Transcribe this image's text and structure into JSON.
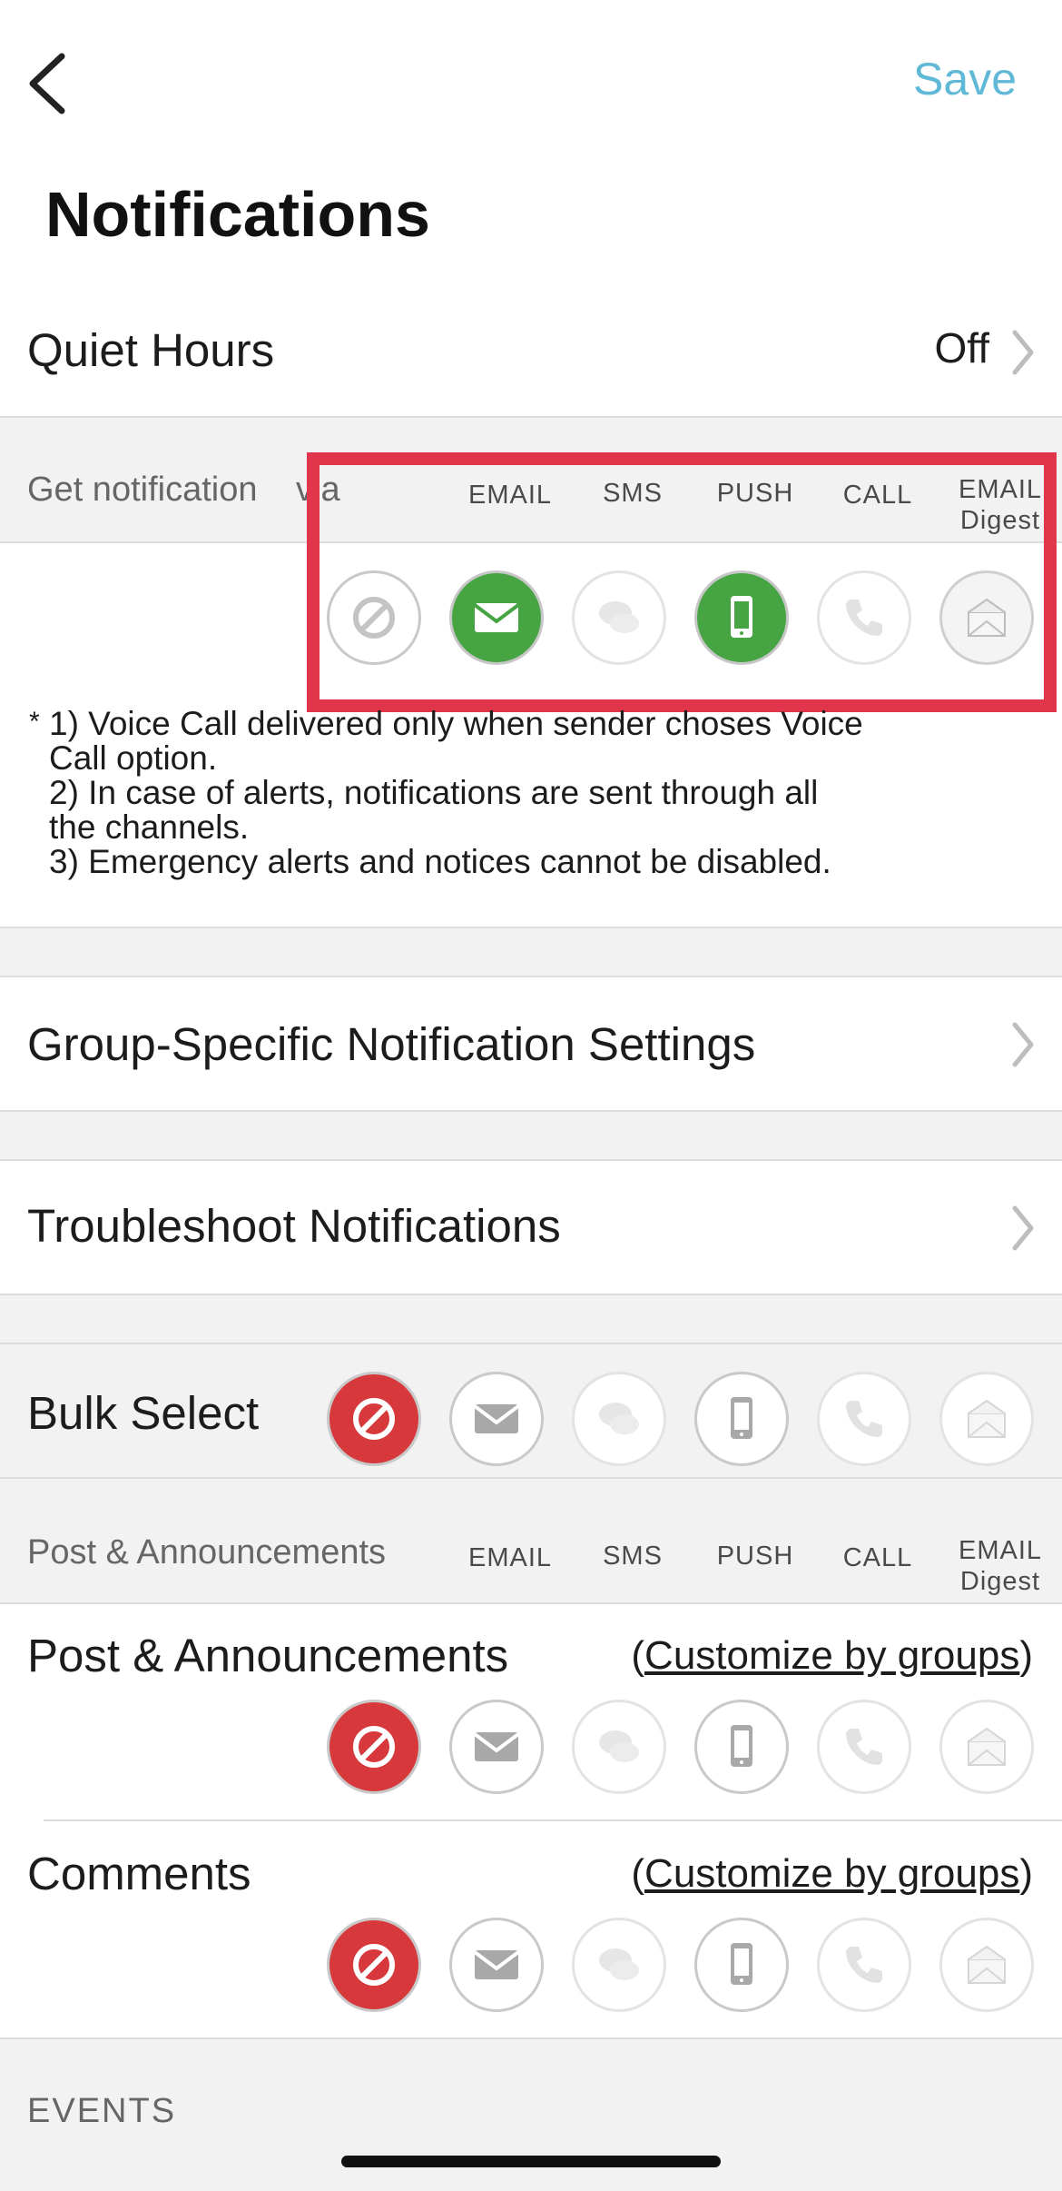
{
  "header": {
    "title": "Notifications",
    "save_label": "Save"
  },
  "quiet_hours": {
    "label": "Quiet Hours",
    "value": "Off"
  },
  "channels_header": {
    "label_prefix": "Get notification",
    "label_suffix": "via",
    "columns": [
      "EMAIL",
      "SMS",
      "PUSH",
      "CALL",
      "EMAIL",
      "Digest"
    ]
  },
  "channel_states": {
    "none": "off",
    "email": "on",
    "sms": "off",
    "push": "on",
    "call": "off",
    "email_digest": "off"
  },
  "note": {
    "star": "*",
    "lines": [
      "1) Voice Call delivered only when sender choses Voice",
      "Call option.",
      "2) In case of alerts, notifications are sent through all",
      "the channels.",
      "3) Emergency alerts and notices cannot be disabled."
    ]
  },
  "menu": {
    "group_specific": "Group-Specific Notification Settings",
    "troubleshoot": "Troubleshoot Notifications"
  },
  "bulk_select": {
    "label": "Bulk Select",
    "selected": "none"
  },
  "post_section": {
    "label": "Post & Announcements",
    "columns": [
      "EMAIL",
      "SMS",
      "PUSH",
      "CALL",
      "EMAIL",
      "Digest"
    ]
  },
  "items": [
    {
      "title": "Post & Announcements",
      "link_open": "(",
      "link": "Customize by groups",
      "link_close": ")",
      "selected": "none"
    },
    {
      "title": "Comments",
      "link_open": "(",
      "link": "Customize by groups",
      "link_close": ")",
      "selected": "none"
    }
  ],
  "events_label": "EVENTS",
  "colors": {
    "accent": "#5fb9d6",
    "on": "#46a443",
    "blocked": "#d6383b",
    "highlight": "#e0354a"
  },
  "icons": [
    "back-chevron-icon",
    "chevron-right-icon",
    "no-entry-icon",
    "envelope-icon",
    "chat-bubbles-icon",
    "mobile-phone-icon",
    "phone-handset-icon",
    "envelope-digest-icon"
  ]
}
